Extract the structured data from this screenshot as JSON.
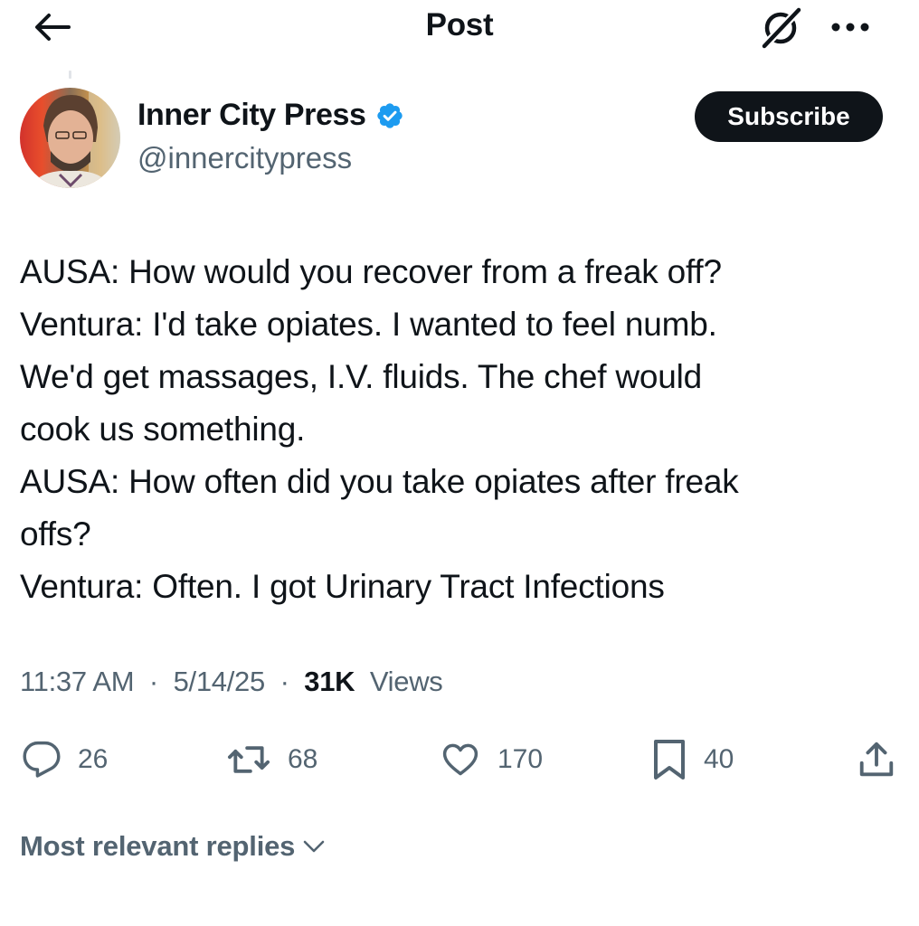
{
  "header": {
    "title": "Post",
    "back_icon": "arrow-left-icon",
    "grok_icon": "grok-icon",
    "more_icon": "more-horizontal-icon"
  },
  "author": {
    "display_name": "Inner City Press",
    "handle": "@innercitypress",
    "verified": true,
    "verified_color": "#1d9bf0",
    "subscribe_label": "Subscribe"
  },
  "post": {
    "lines": [
      "AUSA: How would you recover from a freak off?",
      "Ventura: I'd take opiates. I wanted to feel numb.",
      "We'd get massages, I.V. fluids. The chef would",
      "cook us something.",
      "AUSA: How often did you take opiates after freak",
      "offs?",
      "Ventura: Often. I got Urinary Tract Infections"
    ],
    "time": "11:37 AM",
    "separator": "·",
    "date": "5/14/25",
    "views_count": "31K",
    "views_label": "Views"
  },
  "actions": {
    "reply_count": "26",
    "retweet_count": "68",
    "like_count": "170",
    "bookmark_count": "40"
  },
  "replies": {
    "sort_label": "Most relevant replies"
  },
  "colors": {
    "text_primary": "#0f1419",
    "text_secondary": "#536471",
    "accent": "#1d9bf0",
    "button_dark": "#0f1419"
  }
}
